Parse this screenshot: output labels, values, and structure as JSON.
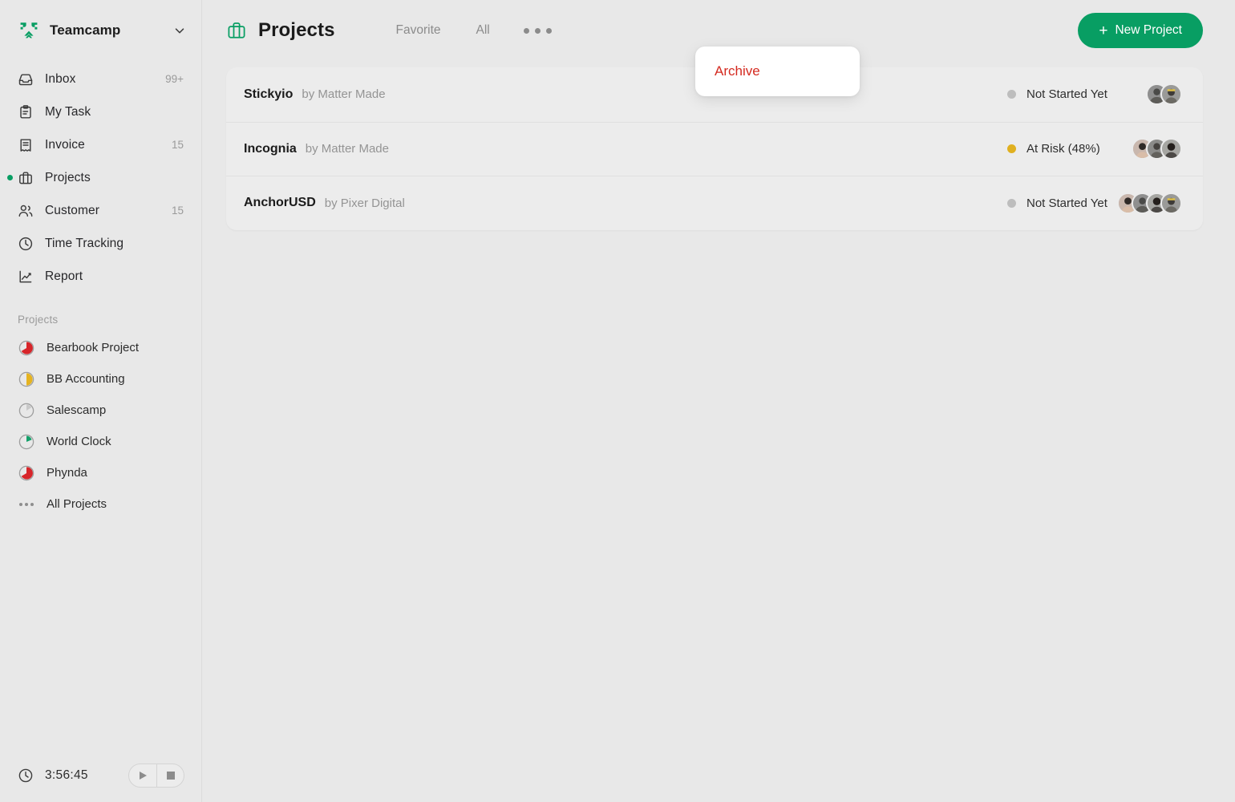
{
  "workspace": {
    "name": "Teamcamp",
    "logo_icon": "teamcamp-logo",
    "chevron_icon": "chevron-down-icon"
  },
  "sidebar": {
    "nav": [
      {
        "label": "Inbox",
        "badge": "99+",
        "icon": "inbox-icon",
        "active": false
      },
      {
        "label": "My Task",
        "badge": "",
        "icon": "clipboard-icon",
        "active": false
      },
      {
        "label": "Invoice",
        "badge": "15",
        "icon": "invoice-icon",
        "active": false
      },
      {
        "label": "Projects",
        "badge": "",
        "icon": "briefcase-icon",
        "active": true
      },
      {
        "label": "Customer",
        "badge": "15",
        "icon": "people-icon",
        "active": false
      },
      {
        "label": "Time Tracking",
        "badge": "",
        "icon": "clock-icon",
        "active": false
      },
      {
        "label": "Report",
        "badge": "",
        "icon": "chart-line-icon",
        "active": false
      }
    ],
    "projects_section_title": "Projects",
    "projects": [
      {
        "label": "Bearbook Project",
        "icon": "pie-progress-icon",
        "color": "#d7252a",
        "percent": 62
      },
      {
        "label": "BB Accounting",
        "icon": "pie-progress-icon",
        "color": "#e5b320",
        "percent": 50
      },
      {
        "label": "Salescamp",
        "icon": "pie-progress-icon",
        "color": "#c9c9c9",
        "percent": 14
      },
      {
        "label": "World Clock",
        "icon": "pie-progress-icon",
        "color": "#13a06a",
        "percent": 26
      },
      {
        "label": "Phynda",
        "icon": "pie-progress-icon",
        "color": "#d7252a",
        "percent": 62
      }
    ],
    "all_projects_label": "All Projects",
    "all_projects_icon": "ellipsis-icon"
  },
  "timer": {
    "icon": "clock-icon",
    "value": "3:56:45",
    "play_icon": "play-icon",
    "stop_icon": "stop-icon"
  },
  "header": {
    "icon": "briefcase-icon",
    "title": "Projects",
    "tabs": [
      {
        "label": "Favorite",
        "active": false
      },
      {
        "label": "All",
        "active": false
      }
    ],
    "more_icon": "ellipsis-icon",
    "new_project_label": "New Project",
    "new_project_plus": "+"
  },
  "popup": {
    "items": [
      {
        "label": "Archive",
        "color": "#d42a20"
      }
    ]
  },
  "projects_table": {
    "rows": [
      {
        "name": "Stickyio",
        "by": "by Matter Made",
        "status": "Not Started Yet",
        "status_color": "#bdbdbd",
        "members": 2
      },
      {
        "name": "Incognia",
        "by": "by Matter Made",
        "status": "At Risk (48%)",
        "status_color": "#e0b020",
        "members": 3
      },
      {
        "name": "AnchorUSD",
        "by": "by Pixer Digital",
        "status": "Not Started Yet",
        "status_color": "#bdbdbd",
        "members": 4
      }
    ]
  },
  "theme": {
    "brand_green": "#089e63",
    "page_bg": "#e8e8e8",
    "card_bg": "#ececec",
    "danger_red": "#d42a20"
  }
}
